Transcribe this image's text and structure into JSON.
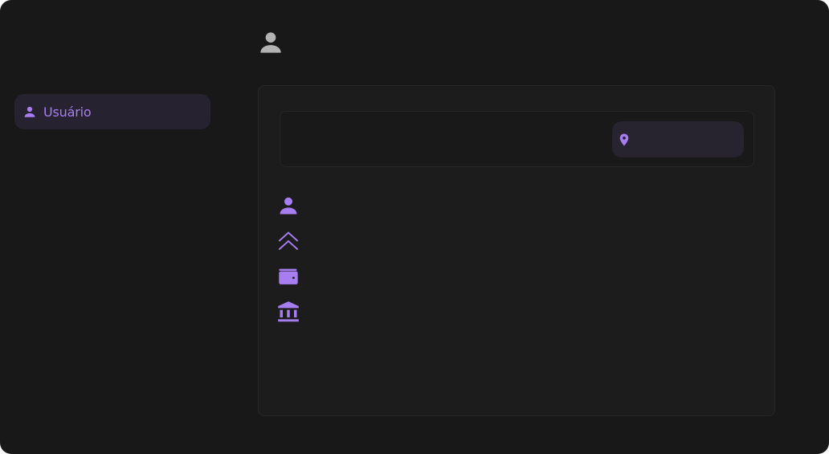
{
  "colors": {
    "accent": "#a77ef2",
    "window_bg": "#181818",
    "card_bg": "#1c1c1c",
    "chip_bg": "#27232f",
    "muted_icon": "#b3b3b3"
  },
  "header": {
    "avatar_icon": "person-icon"
  },
  "sidebar": {
    "items": [
      {
        "label": "Usuário",
        "icon": "person-icon"
      }
    ]
  },
  "main": {
    "location_chip": {
      "icon": "location-pin-icon"
    },
    "icons": [
      "person-icon",
      "double-chevron-up-icon",
      "wallet-icon",
      "bank-icon"
    ]
  }
}
